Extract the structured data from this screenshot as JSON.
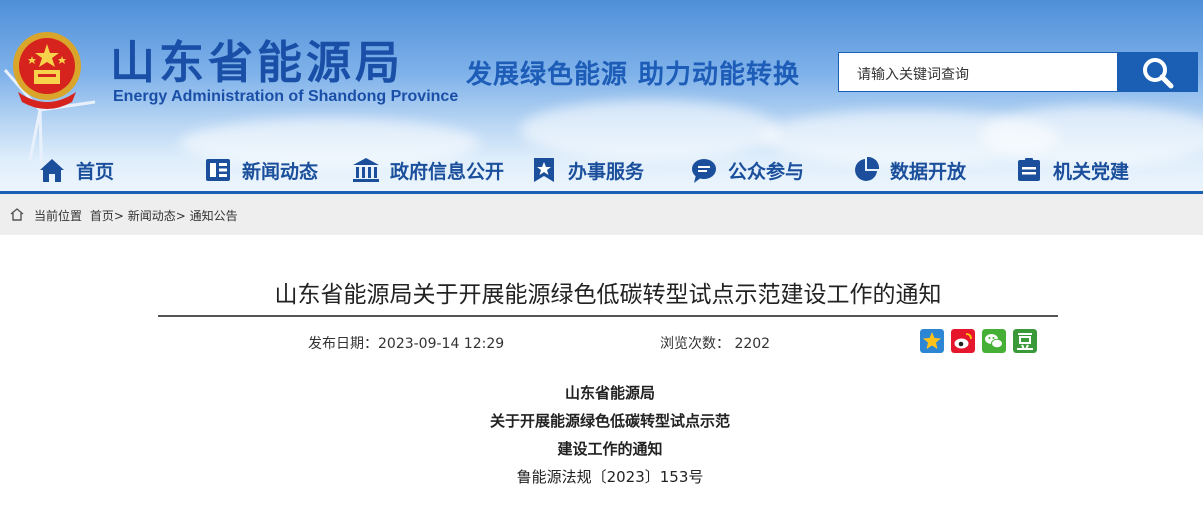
{
  "header": {
    "site_title": "山东省能源局",
    "site_subtitle": "Energy Administration of Shandong Province",
    "slogan": "发展绿色能源 助力动能转换",
    "search_placeholder": "请输入关键词查询"
  },
  "nav": {
    "items": [
      {
        "label": "首页",
        "icon": "home-icon"
      },
      {
        "label": "新闻动态",
        "icon": "news-icon"
      },
      {
        "label": "政府信息公开",
        "icon": "government-building-icon"
      },
      {
        "label": "办事服务",
        "icon": "service-star-icon"
      },
      {
        "label": "公众参与",
        "icon": "chat-bubble-icon"
      },
      {
        "label": "数据开放",
        "icon": "pie-chart-icon"
      },
      {
        "label": "机关党建",
        "icon": "badge-icon"
      }
    ]
  },
  "breadcrumb": {
    "prefix": "当前位置",
    "items": [
      "首页>",
      "新闻动态>",
      "通知公告"
    ]
  },
  "article": {
    "title": "山东省能源局关于开展能源绿色低碳转型试点示范建设工作的通知",
    "date_label": "发布日期：2023-09-14 12:29",
    "views_label": "浏览次数： 2202",
    "share_icons": [
      "qzone-star-icon",
      "weibo-icon",
      "wechat-icon",
      "douban-icon"
    ],
    "body_lines": [
      "山东省能源局",
      "关于开展能源绿色低碳转型试点示范",
      "建设工作的通知",
      "鲁能源法规〔2023〕153号"
    ]
  },
  "colors": {
    "brand_blue": "#1a5fb4",
    "nav_text": "#1b4f9c",
    "breadcrumb_bg": "#eeeeee"
  }
}
